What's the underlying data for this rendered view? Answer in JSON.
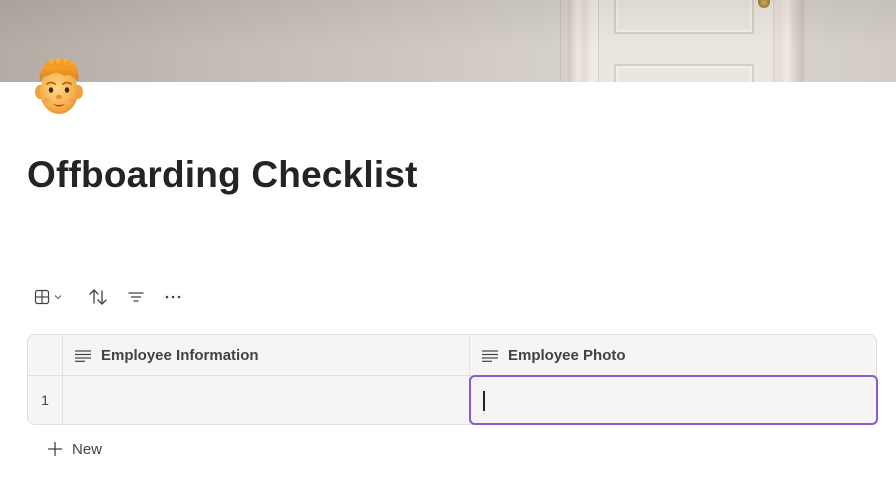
{
  "page": {
    "title": "Offboarding Checklist",
    "icon": "person-emoji-icon"
  },
  "cover": {
    "image": "door-in-wall-photo"
  },
  "toolbar": {
    "items": [
      {
        "name": "grid-view-icon",
        "has_dropdown": true
      },
      {
        "name": "sort-icon"
      },
      {
        "name": "filter-icon"
      },
      {
        "name": "more-icon"
      }
    ]
  },
  "table": {
    "columns": [
      {
        "label": "Employee Information",
        "icon": "text-lines-icon"
      },
      {
        "label": "Employee Photo",
        "icon": "text-lines-icon"
      }
    ],
    "rows": [
      {
        "number": "1",
        "cells": [
          "",
          ""
        ]
      }
    ],
    "active_cell": {
      "row": 0,
      "column": 1
    },
    "accent_color": "#8a5bd6"
  },
  "new_row": {
    "label": "New",
    "icon": "plus-icon"
  }
}
